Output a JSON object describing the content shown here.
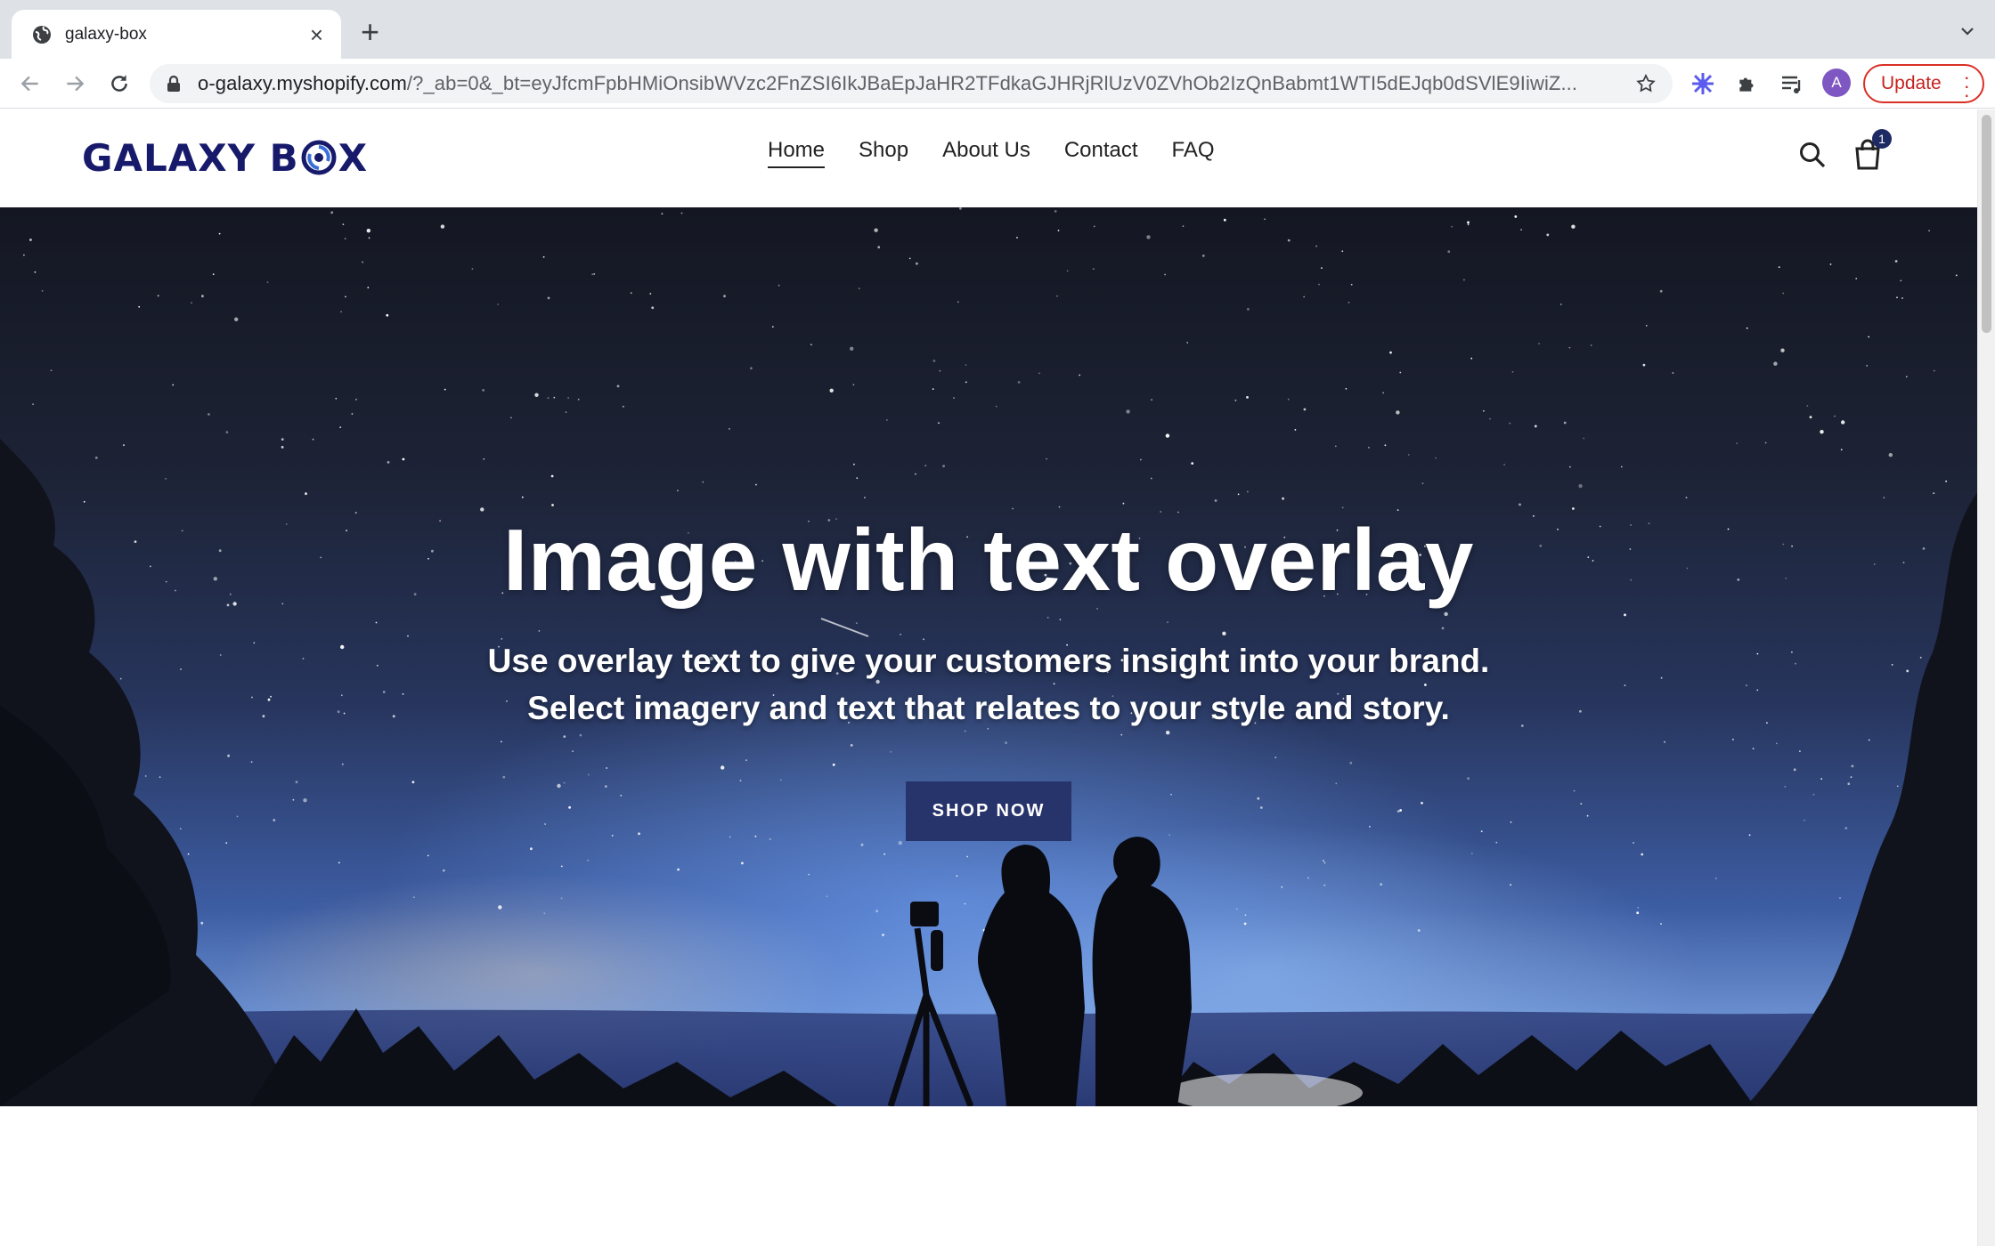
{
  "browser": {
    "tab_title": "galaxy-box",
    "url_host": "o-galaxy.myshopify.com",
    "url_path": "/?_ab=0&_bt=eyJfcmFpbHMiOnsibWVzc2FnZSI6IkJBaEpJaHR2TFdkaGJHRjRlUzV0ZVhOb2IzQnBabmt1WTI5dEJqb0dSVlE9IiwiZ...",
    "profile_initial": "A",
    "update_label": "Update",
    "colors": {
      "tabstrip": "#dee1e6",
      "update": "#c5221f",
      "avatar": "#7e57c2"
    }
  },
  "site": {
    "logo_left": "GALAXY B",
    "logo_right": "X",
    "nav": [
      {
        "label": "Home",
        "active": true
      },
      {
        "label": "Shop"
      },
      {
        "label": "About Us"
      },
      {
        "label": "Contact"
      },
      {
        "label": "FAQ"
      }
    ],
    "cart_count": "1",
    "icons": {
      "search": "search-icon",
      "cart": "shopping-bag-icon"
    },
    "colors": {
      "brand": "#171a6b",
      "button": "#27336b"
    }
  },
  "hero": {
    "title": "Image with text overlay",
    "subtitle": "Use overlay text to give your customers insight into your brand. Select imagery and text that relates to your style and story.",
    "button_label": "SHOP NOW"
  }
}
